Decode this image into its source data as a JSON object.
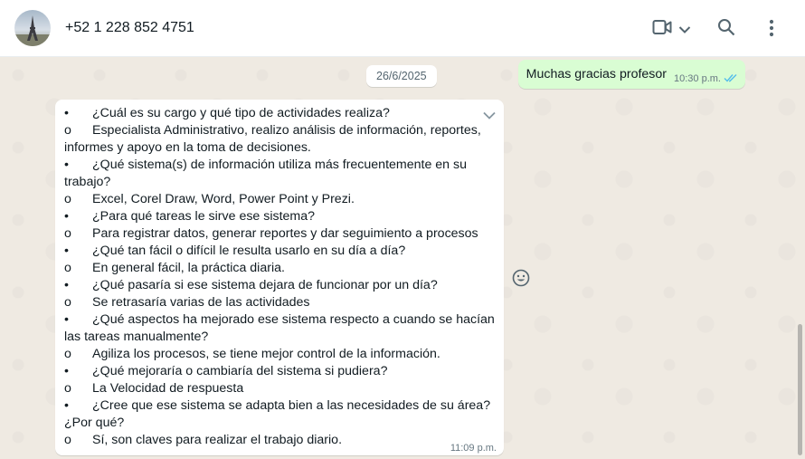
{
  "header": {
    "contact_name": "+52 1 228 852 4751",
    "icons": [
      "video-call-icon",
      "chevron-down-icon",
      "search-icon",
      "kebab-menu-icon"
    ]
  },
  "chat": {
    "outgoing": {
      "text": "Muchas gracias profesor",
      "time": "10:30 p.m.",
      "status": "read"
    },
    "date_chip": "26/6/2025",
    "incoming": {
      "time": "11:09 p.m.",
      "lines": [
        {
          "bullet": "•",
          "text": "¿Cuál es su cargo y qué tipo de actividades realiza?"
        },
        {
          "bullet": "o",
          "text": "Especialista Administrativo, realizo análisis de información, reportes,"
        },
        {
          "bullet": "",
          "text": "informes y apoyo en la toma de decisiones."
        },
        {
          "bullet": "•",
          "text": "¿Qué sistema(s) de información utiliza más frecuentemente en su"
        },
        {
          "bullet": "",
          "text": "trabajo?"
        },
        {
          "bullet": "o",
          "text": "Excel, Corel Draw, Word, Power Point y Prezi."
        },
        {
          "bullet": "•",
          "text": "¿Para qué tareas le sirve ese sistema?"
        },
        {
          "bullet": "o",
          "text": "Para registrar datos, generar reportes y dar seguimiento a procesos"
        },
        {
          "bullet": "•",
          "text": "¿Qué tan fácil o difícil le resulta usarlo en su día a día?"
        },
        {
          "bullet": "o",
          "text": "En general fácil, la práctica diaria."
        },
        {
          "bullet": "•",
          "text": "¿Qué pasaría si ese sistema dejara de funcionar por un día?"
        },
        {
          "bullet": "o",
          "text": "Se retrasaría varias de las actividades"
        },
        {
          "bullet": "•",
          "text": "¿Qué aspectos ha mejorado ese sistema respecto a cuando se hacían"
        },
        {
          "bullet": "",
          "text": "las tareas manualmente?"
        },
        {
          "bullet": "o",
          "text": "Agiliza los procesos, se tiene mejor control de la información."
        },
        {
          "bullet": "•",
          "text": "¿Qué mejoraría o cambiaría del sistema si pudiera?"
        },
        {
          "bullet": "o",
          "text": "La Velocidad de respuesta"
        },
        {
          "bullet": "•",
          "text": "¿Cree que ese sistema se adapta bien a las necesidades de su área?"
        },
        {
          "bullet": "",
          "text": "¿Por qué?"
        },
        {
          "bullet": "o",
          "text": "Sí, son claves para realizar el trabajo diario."
        }
      ]
    }
  },
  "colors": {
    "outgoing_bubble": "#d9fdd3",
    "incoming_bubble": "#ffffff",
    "chat_background": "#efeae2",
    "read_ticks": "#53bdeb"
  }
}
